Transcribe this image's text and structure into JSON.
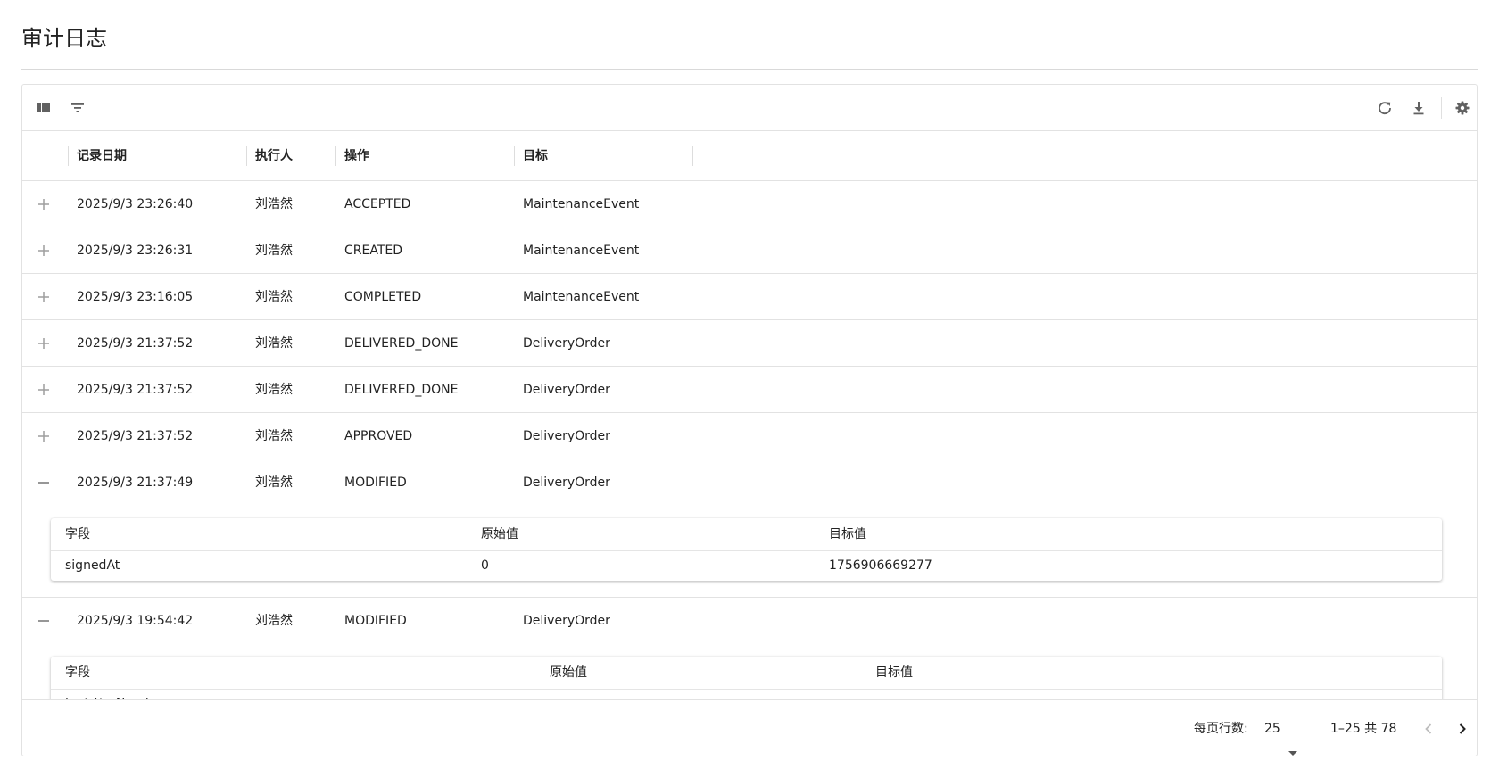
{
  "page": {
    "title": "审计日志"
  },
  "toolbar": {
    "left_icons": [
      "columns-icon",
      "filter-icon"
    ],
    "right_icons": [
      "refresh-icon",
      "download-icon",
      "settings-icon"
    ]
  },
  "table": {
    "columns": [
      "记录日期",
      "执行人",
      "操作",
      "目标"
    ],
    "rows": [
      {
        "date": "2025/9/3 23:26:40",
        "user": "刘浩然",
        "action": "ACCEPTED",
        "target": "MaintenanceEvent",
        "expanded": false
      },
      {
        "date": "2025/9/3 23:26:31",
        "user": "刘浩然",
        "action": "CREATED",
        "target": "MaintenanceEvent",
        "expanded": false
      },
      {
        "date": "2025/9/3 23:16:05",
        "user": "刘浩然",
        "action": "COMPLETED",
        "target": "MaintenanceEvent",
        "expanded": false
      },
      {
        "date": "2025/9/3 21:37:52",
        "user": "刘浩然",
        "action": "DELIVERED_DONE",
        "target": "DeliveryOrder",
        "expanded": false
      },
      {
        "date": "2025/9/3 21:37:52",
        "user": "刘浩然",
        "action": "DELIVERED_DONE",
        "target": "DeliveryOrder",
        "expanded": false
      },
      {
        "date": "2025/9/3 21:37:52",
        "user": "刘浩然",
        "action": "APPROVED",
        "target": "DeliveryOrder",
        "expanded": false
      },
      {
        "date": "2025/9/3 21:37:49",
        "user": "刘浩然",
        "action": "MODIFIED",
        "target": "DeliveryOrder",
        "expanded": true
      },
      {
        "date": "2025/9/3 19:54:42",
        "user": "刘浩然",
        "action": "MODIFIED",
        "target": "DeliveryOrder",
        "expanded": true
      }
    ],
    "details": [
      {
        "headers": [
          "字段",
          "原始值",
          "目标值"
        ],
        "rows": [
          {
            "field": "signedAt",
            "old": "0",
            "new": "1756906669277"
          }
        ]
      },
      {
        "headers": [
          "字段",
          "原始值",
          "目标值"
        ],
        "rows": [
          {
            "field": "logisticsNumber",
            "old": "",
            "new": ""
          }
        ]
      }
    ]
  },
  "footer": {
    "rows_per_page_label": "每页行数:",
    "rows_per_page_value": "25",
    "range_text": "1–25 共 78"
  },
  "colors": {
    "text": "#222222",
    "border": "#e2e2e2",
    "icon": "#616161"
  }
}
